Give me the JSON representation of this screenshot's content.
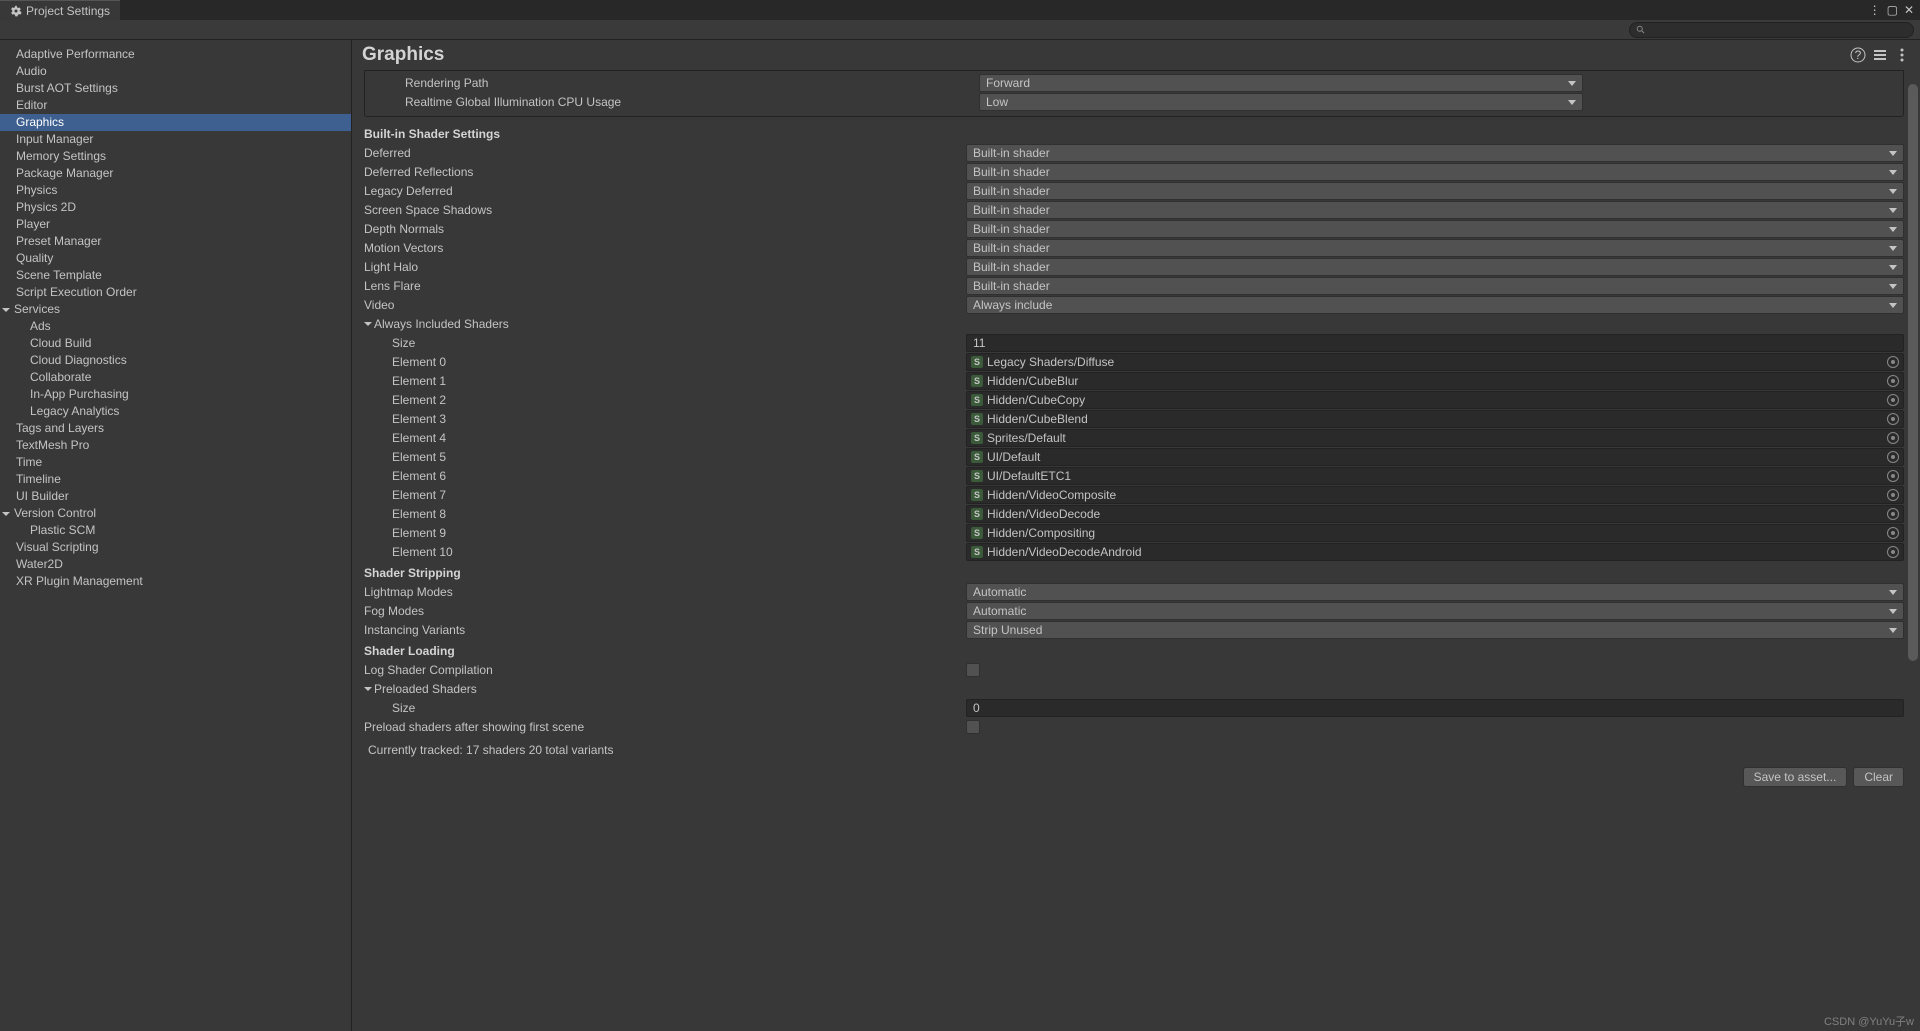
{
  "window": {
    "title": "Project Settings"
  },
  "sidebar": {
    "items": [
      {
        "label": "Adaptive Performance"
      },
      {
        "label": "Audio"
      },
      {
        "label": "Burst AOT Settings"
      },
      {
        "label": "Editor"
      },
      {
        "label": "Graphics",
        "selected": true
      },
      {
        "label": "Input Manager"
      },
      {
        "label": "Memory Settings"
      },
      {
        "label": "Package Manager"
      },
      {
        "label": "Physics"
      },
      {
        "label": "Physics 2D"
      },
      {
        "label": "Player"
      },
      {
        "label": "Preset Manager"
      },
      {
        "label": "Quality"
      },
      {
        "label": "Scene Template"
      },
      {
        "label": "Script Execution Order"
      },
      {
        "label": "Services",
        "expandable": true
      },
      {
        "label": "Ads",
        "child": true
      },
      {
        "label": "Cloud Build",
        "child": true
      },
      {
        "label": "Cloud Diagnostics",
        "child": true
      },
      {
        "label": "Collaborate",
        "child": true
      },
      {
        "label": "In-App Purchasing",
        "child": true
      },
      {
        "label": "Legacy Analytics",
        "child": true
      },
      {
        "label": "Tags and Layers"
      },
      {
        "label": "TextMesh Pro"
      },
      {
        "label": "Time"
      },
      {
        "label": "Timeline"
      },
      {
        "label": "UI Builder"
      },
      {
        "label": "Version Control",
        "expandable": true
      },
      {
        "label": "Plastic SCM",
        "child": true
      },
      {
        "label": "Visual Scripting"
      },
      {
        "label": "Water2D"
      },
      {
        "label": "XR Plugin Management"
      }
    ]
  },
  "header": {
    "title": "Graphics"
  },
  "boxed": {
    "rendering_path": {
      "label": "Rendering Path",
      "value": "Forward"
    },
    "realtime_gi": {
      "label": "Realtime Global Illumination CPU Usage",
      "value": "Low"
    }
  },
  "shader_section": {
    "title": "Built-in Shader Settings",
    "rows": [
      {
        "label": "Deferred",
        "value": "Built-in shader"
      },
      {
        "label": "Deferred Reflections",
        "value": "Built-in shader"
      },
      {
        "label": "Legacy Deferred",
        "value": "Built-in shader"
      },
      {
        "label": "Screen Space Shadows",
        "value": "Built-in shader"
      },
      {
        "label": "Depth Normals",
        "value": "Built-in shader"
      },
      {
        "label": "Motion Vectors",
        "value": "Built-in shader"
      },
      {
        "label": "Light Halo",
        "value": "Built-in shader"
      },
      {
        "label": "Lens Flare",
        "value": "Built-in shader"
      }
    ],
    "video": {
      "label": "Video",
      "value": "Always include"
    }
  },
  "included": {
    "title": "Always Included Shaders",
    "size_label": "Size",
    "size_value": "11",
    "elements": [
      {
        "label": "Element 0",
        "value": "Legacy Shaders/Diffuse"
      },
      {
        "label": "Element 1",
        "value": "Hidden/CubeBlur"
      },
      {
        "label": "Element 2",
        "value": "Hidden/CubeCopy"
      },
      {
        "label": "Element 3",
        "value": "Hidden/CubeBlend"
      },
      {
        "label": "Element 4",
        "value": "Sprites/Default"
      },
      {
        "label": "Element 5",
        "value": "UI/Default"
      },
      {
        "label": "Element 6",
        "value": "UI/DefaultETC1"
      },
      {
        "label": "Element 7",
        "value": "Hidden/VideoComposite"
      },
      {
        "label": "Element 8",
        "value": "Hidden/VideoDecode"
      },
      {
        "label": "Element 9",
        "value": "Hidden/Compositing"
      },
      {
        "label": "Element 10",
        "value": "Hidden/VideoDecodeAndroid"
      }
    ]
  },
  "stripping": {
    "title": "Shader Stripping",
    "rows": [
      {
        "label": "Lightmap Modes",
        "value": "Automatic"
      },
      {
        "label": "Fog Modes",
        "value": "Automatic"
      },
      {
        "label": "Instancing Variants",
        "value": "Strip Unused"
      }
    ]
  },
  "loading": {
    "title": "Shader Loading",
    "log": {
      "label": "Log Shader Compilation"
    },
    "preloaded": {
      "title": "Preloaded Shaders",
      "size_label": "Size",
      "size_value": "0"
    },
    "preload_after": {
      "label": "Preload shaders after showing first scene"
    }
  },
  "tracked": "Currently tracked: 17 shaders 20 total variants",
  "buttons": {
    "save": "Save to asset...",
    "clear": "Clear"
  },
  "watermark": "CSDN @YuYu子w"
}
